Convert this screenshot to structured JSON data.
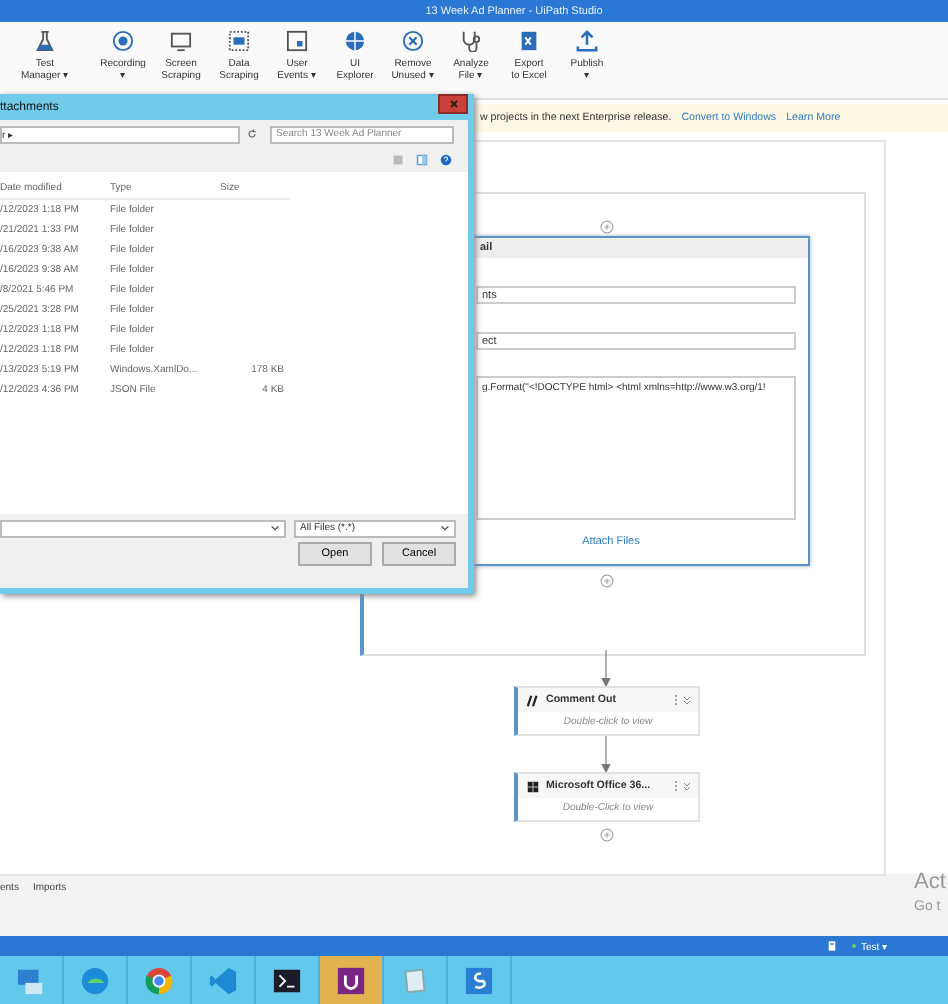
{
  "window": {
    "title": "13 Week Ad Planner - UiPath Studio"
  },
  "ribbon": [
    {
      "lines": [
        "Test",
        "Manager ▾"
      ]
    },
    {
      "lines": [
        "Recording",
        "▾"
      ]
    },
    {
      "lines": [
        "Screen",
        "Scraping"
      ]
    },
    {
      "lines": [
        "Data",
        "Scraping"
      ]
    },
    {
      "lines": [
        "User",
        "Events ▾"
      ]
    },
    {
      "lines": [
        "UI",
        "Explorer"
      ]
    },
    {
      "lines": [
        "Remove",
        "Unused ▾"
      ]
    },
    {
      "lines": [
        "Analyze",
        "File ▾"
      ]
    },
    {
      "lines": [
        "Export",
        "to Excel"
      ]
    },
    {
      "lines": [
        "Publish",
        "▾"
      ]
    }
  ],
  "notification": {
    "text": "w projects in the next Enterprise release.",
    "links": [
      "Convert to Windows",
      "Learn More"
    ]
  },
  "dialog": {
    "title": "ttachments",
    "address": "r ▸",
    "search": {
      "placeholder": "Search 13 Week Ad Planner"
    },
    "columns": [
      "Date modified",
      "Type",
      "Size"
    ],
    "rows": [
      {
        "date": "/12/2023 1:18 PM",
        "type": "File folder"
      },
      {
        "date": "/21/2021 1:33 PM",
        "type": "File folder"
      },
      {
        "date": "/16/2023 9:38 AM",
        "type": "File folder"
      },
      {
        "date": "/16/2023 9:38 AM",
        "type": "File folder"
      },
      {
        "date": "/8/2021 5:46 PM",
        "type": "File folder"
      },
      {
        "date": "/25/2021 3:28 PM",
        "type": "File folder"
      },
      {
        "date": "/12/2023 1:18 PM",
        "type": "File folder"
      },
      {
        "date": "/12/2023 1:18 PM",
        "type": "File folder"
      },
      {
        "date": "/13/2023 5:19 PM",
        "type": "Windows.XamlDo...",
        "size": "178 KB"
      },
      {
        "date": "/12/2023 4:36 PM",
        "type": "JSON File",
        "size": "4 KB"
      }
    ],
    "filter": "All Files (*.*)",
    "buttons": [
      "Open",
      "Cancel"
    ]
  },
  "mail": {
    "title": "ail",
    "fields": [
      "nts",
      "ect"
    ],
    "body": "g.Format(\"<!DOCTYPE html> <html xmlns=http://www.w3.org/1!",
    "link": "Attach Files"
  },
  "activities": [
    {
      "kind": "comment",
      "title": "Comment Out",
      "subtitle": "Double-click to view"
    },
    {
      "kind": "office",
      "title": "Microsoft Office 36...",
      "subtitle": "Double-Click to view"
    }
  ],
  "bottom_tabs": [
    "ents",
    "Imports"
  ],
  "activation": [
    "Act",
    "Go t"
  ],
  "status_bar": {
    "project": "Test ▾"
  },
  "taskbar": [
    {
      "kind": "computer",
      "selected": false
    },
    {
      "kind": "edge",
      "selected": false
    },
    {
      "kind": "chrome",
      "selected": false
    },
    {
      "kind": "vscode",
      "selected": false
    },
    {
      "kind": "terminal",
      "selected": false
    },
    {
      "kind": "uipath",
      "selected": true
    },
    {
      "kind": "notepad",
      "selected": false
    },
    {
      "kind": "studio",
      "selected": false
    }
  ]
}
